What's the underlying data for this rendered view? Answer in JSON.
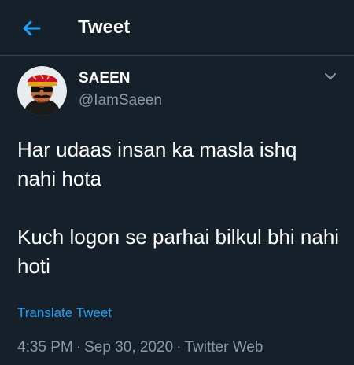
{
  "header": {
    "back_icon": "arrow-left-icon",
    "title": "Tweet"
  },
  "author": {
    "avatar_icon": "cartoon-avatar",
    "display_name": "SAEEN",
    "handle": "@IamSaeen",
    "menu_icon": "chevron-down-icon"
  },
  "tweet": {
    "line_1": "Har udaas insan ka masla ishq nahi hota",
    "line_2": "Kuch logon se parhai bilkul bhi nahi hoti"
  },
  "translate_label": "Translate Tweet",
  "meta": {
    "time": "4:35 PM",
    "separator": "·",
    "date": "Sep 30, 2020",
    "source": "Twitter Web"
  },
  "colors": {
    "background": "#15202b",
    "accent": "#1da1f2",
    "secondary_text": "#8899a6",
    "divider": "#38444d"
  }
}
